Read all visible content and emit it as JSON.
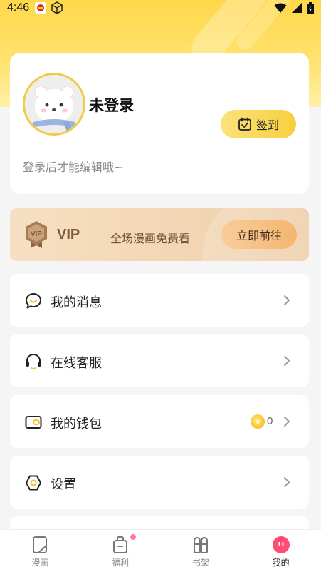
{
  "status_bar": {
    "time": "4:46"
  },
  "profile": {
    "username": "未登录",
    "checkin_label": "签到",
    "login_hint": "登录后才能编辑哦~"
  },
  "vip": {
    "badge_text": "VIP",
    "title": "VIP",
    "description": "全场漫画免费看",
    "button_label": "立即前往"
  },
  "menu": {
    "items": [
      {
        "label": "我的消息",
        "icon": "message-icon"
      },
      {
        "label": "在线客服",
        "icon": "headset-icon"
      },
      {
        "label": "我的钱包",
        "icon": "wallet-icon",
        "coins": "0"
      },
      {
        "label": "设置",
        "icon": "settings-icon"
      }
    ]
  },
  "bottom_nav": {
    "items": [
      {
        "label": "漫画",
        "icon": "comic-icon"
      },
      {
        "label": "福利",
        "icon": "gift-bag-icon"
      },
      {
        "label": "书架",
        "icon": "bookshelf-icon"
      },
      {
        "label": "我的",
        "icon": "profile-icon",
        "active": true
      }
    ]
  },
  "colors": {
    "accent_yellow": "#f7cf3f",
    "vip_bg": "#f2d6b4",
    "active_nav": "#ff4d73"
  }
}
